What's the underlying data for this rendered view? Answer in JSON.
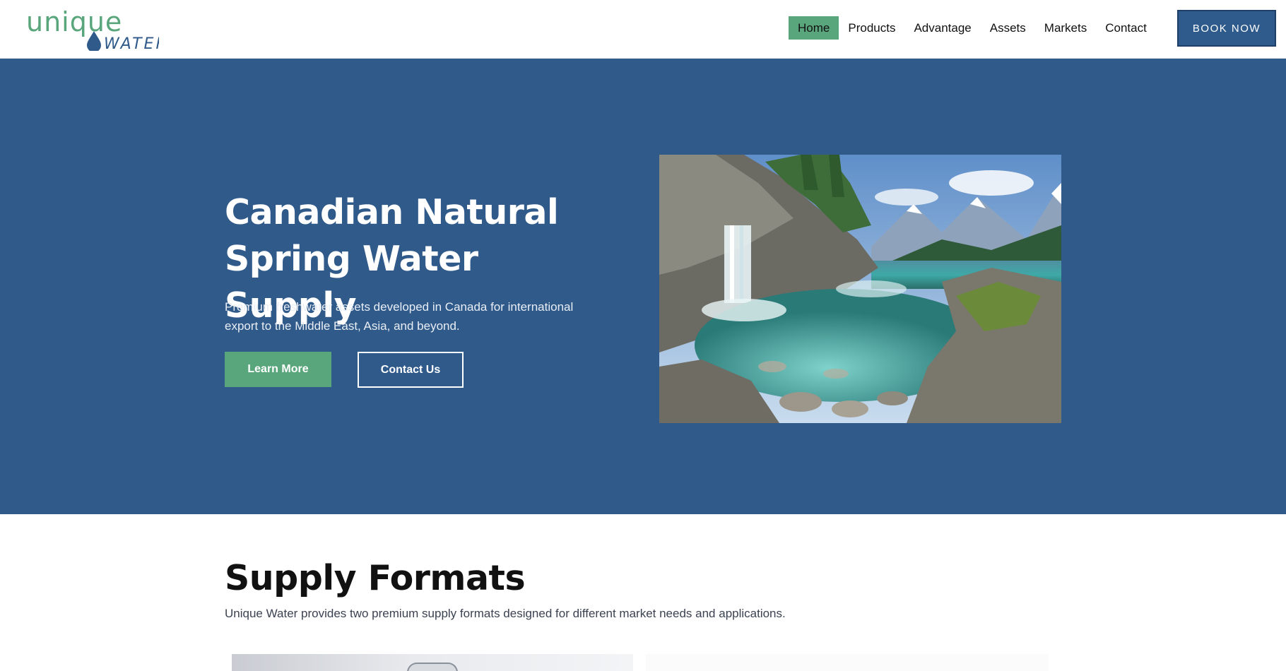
{
  "brand": {
    "logo_top": "unique",
    "logo_bottom": "WATER",
    "primary_color": "#2f5a8a",
    "accent_color": "#5aa67c"
  },
  "nav": {
    "items": [
      {
        "label": "Home",
        "active": true
      },
      {
        "label": "Products",
        "active": false
      },
      {
        "label": "Advantage",
        "active": false
      },
      {
        "label": "Assets",
        "active": false
      },
      {
        "label": "Markets",
        "active": false
      },
      {
        "label": "Contact",
        "active": false
      }
    ],
    "book_label": "BOOK NOW"
  },
  "hero": {
    "title": "Canadian Natural Spring Water Supply",
    "subtitle": "Premium freshwater assets developed in Canada for international export to the Middle East, Asia, and beyond.",
    "learn_more_label": "Learn More",
    "contact_label": "Contact Us"
  },
  "supply": {
    "title": "Supply Formats",
    "subtitle": "Unique Water provides two premium supply formats designed for different market needs and applications."
  }
}
